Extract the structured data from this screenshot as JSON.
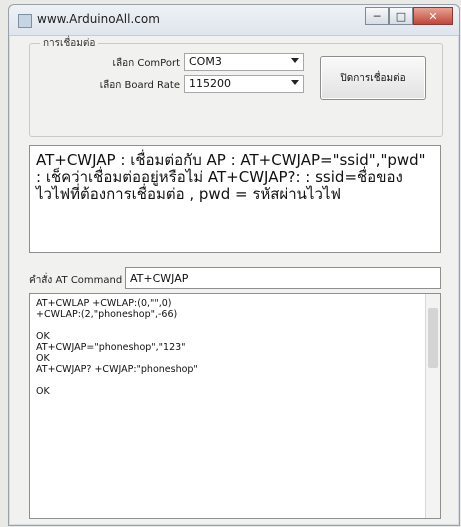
{
  "window": {
    "title": "www.ArduinoAll.com",
    "minimize_glyph": "─",
    "maximize_glyph": "□",
    "close_glyph": "✕"
  },
  "connection_group": {
    "legend": "การเชื่อมต่อ",
    "comport_label": "เลือก ComPort",
    "comport_value": "COM3",
    "baud_label": "เลือก Board Rate",
    "baud_value": "115200",
    "disconnect_button": "ปิดการเชื่อมต่อ"
  },
  "description": {
    "text": "AT+CWJAP : เชื่อมต่อกับ AP : AT+CWJAP=\"ssid\",\"pwd\" : เช็คว่าเชื่อมต่ออยู่หรือไม่ AT+CWJAP?: : ssid=ชื่อของไวไฟที่ต้องการเชื่อมต่อ , pwd = รหัสผ่านไวไฟ"
  },
  "command": {
    "label": "คำสั่ง AT Command",
    "value": "AT+CWJAP"
  },
  "output": {
    "lines": [
      "AT+CWLAP +CWLAP:(0,\"\",0)",
      "+CWLAP:(2,\"phoneshop\",-66)",
      "",
      "OK",
      "AT+CWJAP=\"phoneshop\",\"123\"",
      "OK",
      "AT+CWJAP? +CWJAP:\"phoneshop\"",
      "",
      "OK"
    ]
  }
}
